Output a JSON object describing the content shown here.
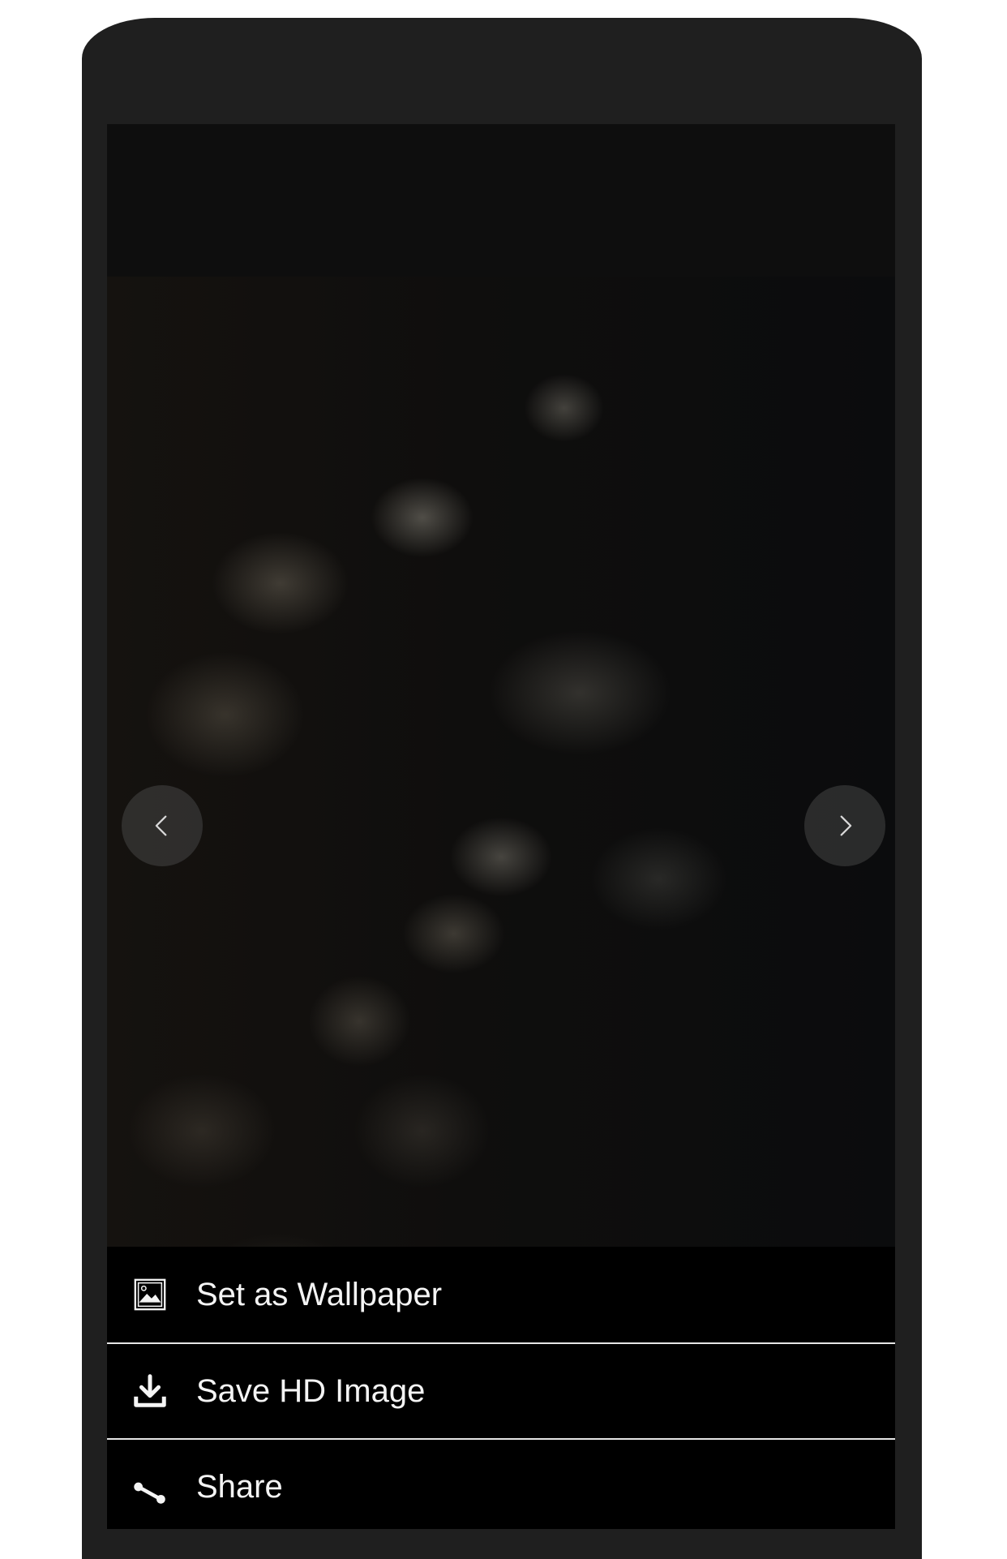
{
  "viewer": {
    "prev_icon": "chevron-left-icon",
    "next_icon": "chevron-right-icon"
  },
  "actions": [
    {
      "label": "Set as Wallpaper",
      "icon": "image-icon"
    },
    {
      "label": "Save HD Image",
      "icon": "download-icon"
    },
    {
      "label": "Share",
      "icon": "share-icon"
    }
  ],
  "colors": {
    "frame": "#1f1f1f",
    "screen": "#0e0e0e",
    "action_bg": "#000000",
    "action_text": "#f4f4f4",
    "divider": "#e6e6e6"
  }
}
